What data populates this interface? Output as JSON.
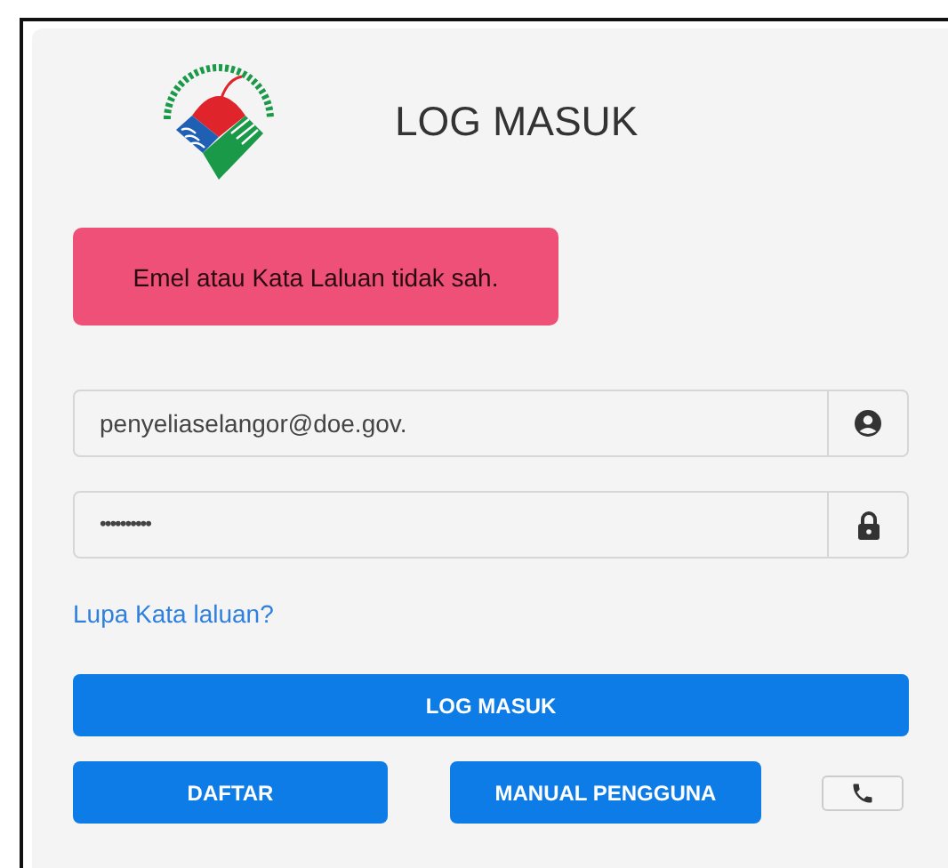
{
  "title": "LOG MASUK",
  "alert": "Emel atau Kata Laluan tidak sah.",
  "email": {
    "value": "penyeliaselangor@doe.gov."
  },
  "password": {
    "value": "••••••••••"
  },
  "forgot_link": "Lupa Kata laluan?",
  "login_button": "LOG MASUK",
  "buttons": [
    "DAFTAR",
    "MANUAL PENGGUNA"
  ]
}
